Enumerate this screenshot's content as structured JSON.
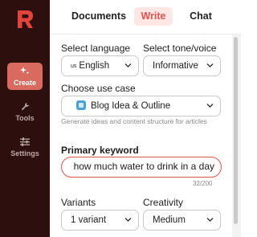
{
  "rail": {
    "logo": "app-logo-R",
    "items": [
      {
        "label": "Create",
        "icon": "sparkles-icon",
        "active": true
      },
      {
        "label": "Tools",
        "icon": "wrench-icon",
        "active": false
      },
      {
        "label": "Settings",
        "icon": "sliders-icon",
        "active": false
      }
    ]
  },
  "tabs": [
    {
      "label": "Documents",
      "active": false
    },
    {
      "label": "Write",
      "active": true
    },
    {
      "label": "Chat",
      "active": false
    }
  ],
  "form": {
    "language": {
      "label": "Select language",
      "flag": "us",
      "value": "English"
    },
    "tone": {
      "label": "Select tone/voice",
      "value": "Informative"
    },
    "use_case": {
      "label": "Choose use case",
      "value": "Blog Idea & Outline",
      "hint": "Generate ideas and content structure for articles"
    },
    "keyword": {
      "label": "Primary keyword",
      "value": "how much water to drink in a day",
      "counter": "32/200"
    },
    "variants": {
      "label": "Variants",
      "value": "1 variant"
    },
    "creativity": {
      "label": "Creativity",
      "value": "Medium"
    }
  },
  "colors": {
    "accent": "#e0544d",
    "rail_bg": "#2d0f0e",
    "active_rail": "#d96a5f",
    "write_tab_bg": "#fde6e3"
  }
}
